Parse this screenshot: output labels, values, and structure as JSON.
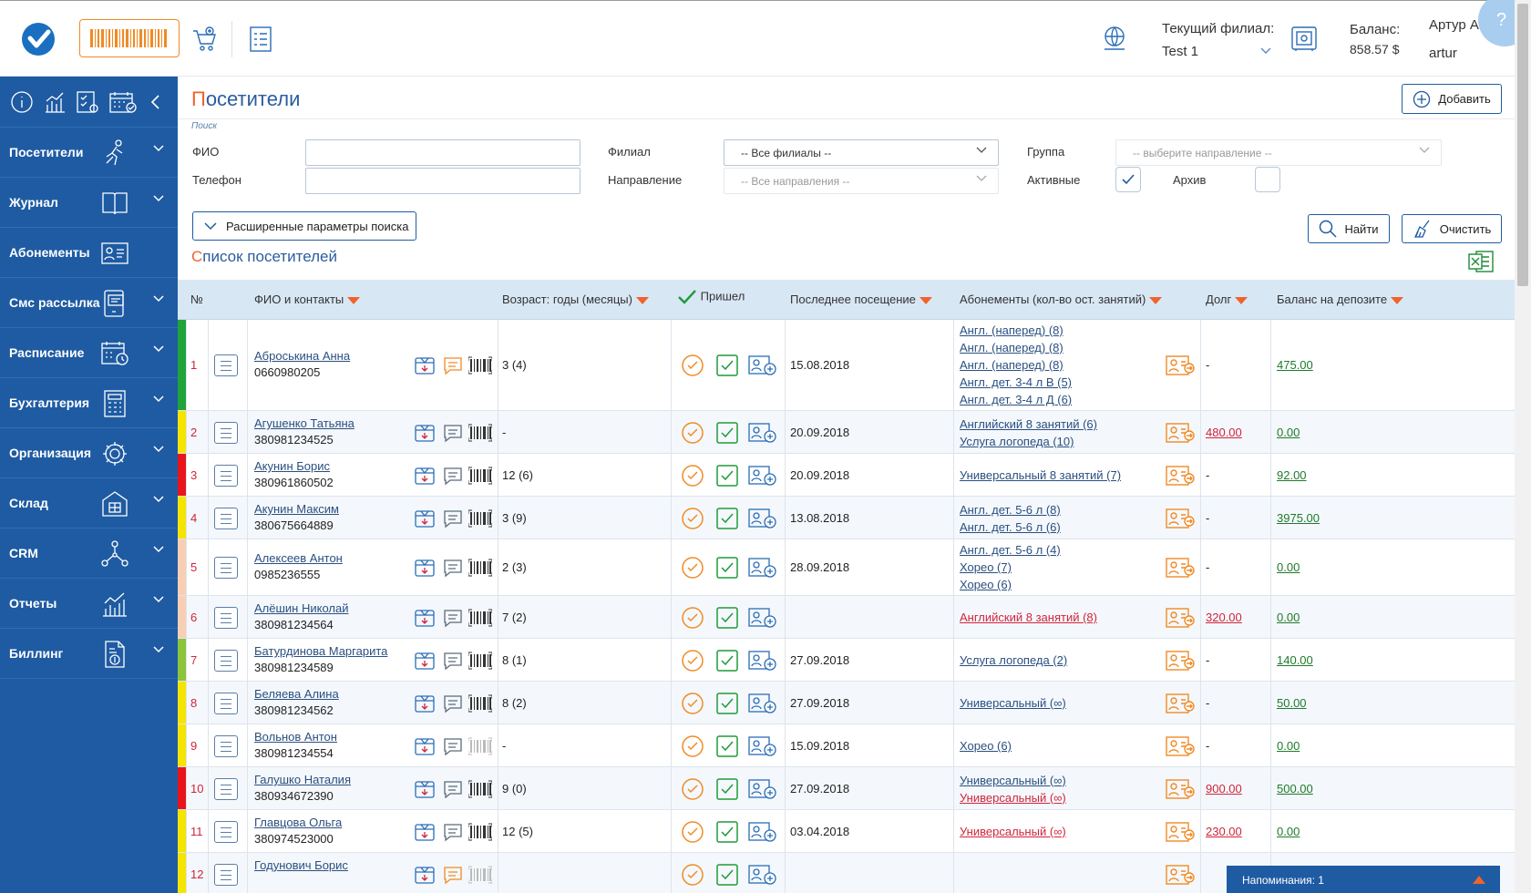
{
  "header": {
    "branch_label": "Текущий филиал:",
    "branch_value": "Test 1",
    "balance_label": "Баланс:",
    "balance_value": "858.57 $",
    "user_name": "Артур А.",
    "user_login": "artur",
    "help": "?"
  },
  "sidebar": {
    "items": [
      {
        "label": "Посетители",
        "icon": "running-person-icon",
        "has_chevron": true
      },
      {
        "label": "Журнал",
        "icon": "book-icon",
        "has_chevron": true
      },
      {
        "label": "Абонементы",
        "icon": "id-card-icon",
        "has_chevron": false
      },
      {
        "label": "Смс рассылка",
        "icon": "sms-device-icon",
        "has_chevron": true
      },
      {
        "label": "Расписание",
        "icon": "calendar-clock-icon",
        "has_chevron": true
      },
      {
        "label": "Бухгалтерия",
        "icon": "calculator-icon",
        "has_chevron": true
      },
      {
        "label": "Организация",
        "icon": "gear-icon",
        "has_chevron": true
      },
      {
        "label": "Склад",
        "icon": "warehouse-icon",
        "has_chevron": true
      },
      {
        "label": "CRM",
        "icon": "network-icon",
        "has_chevron": true
      },
      {
        "label": "Отчеты",
        "icon": "chart-icon",
        "has_chevron": true
      },
      {
        "label": "Биллинг",
        "icon": "invoice-icon",
        "has_chevron": true
      }
    ]
  },
  "page": {
    "title_first": "П",
    "title_rest": "осетители",
    "add_label": "Добавить",
    "search_caption": "Поиск"
  },
  "filters": {
    "fio_label": "ФИО",
    "phone_label": "Телефон",
    "branch_label": "Филиал",
    "branch_value": "-- Все филиалы --",
    "direction_label": "Направление",
    "direction_value": "-- Все направления --",
    "group_label": "Группа",
    "group_value": "-- выберите направление --",
    "active_label": "Активные",
    "active_checked": true,
    "archive_label": "Архив",
    "archive_checked": false,
    "advanced_label": "Расширенные параметры поиска",
    "find_label": "Найти",
    "clear_label": "Очистить"
  },
  "list": {
    "title_first": "С",
    "title_rest": "писок посетителей",
    "columns": {
      "num": "№",
      "name": "ФИО и контакты",
      "age": "Возраст: годы (месяцы)",
      "came": "Пришел",
      "last": "Последнее посещение",
      "subs": "Абонементы (кол-во ост. занятий)",
      "debt": "Долг",
      "deposit": "Баланс на депозите"
    },
    "rows": [
      {
        "num": "1",
        "name": "Аброськина Анна",
        "phone": "0660980205",
        "age": "3 (4)",
        "last": "15.08.2018",
        "subs": [
          {
            "t": "Англ. (наперед) (8)",
            "red": false
          },
          {
            "t": "Англ. (наперед) (8)",
            "red": false
          },
          {
            "t": "Англ. (наперед) (8)",
            "red": false
          },
          {
            "t": "Англ. дет. 3-4 л В (5)",
            "red": false
          },
          {
            "t": "Англ. дет. 3-4 л Д (6)",
            "red": false
          }
        ],
        "debt": "-",
        "debt_red": false,
        "deposit": "475.00",
        "stripe": "#1fa33a",
        "msg_orange": true,
        "barcode_light": false
      },
      {
        "num": "2",
        "name": "Агушенко Татьяна",
        "phone": "380981234525",
        "age": "-",
        "last": "20.09.2018",
        "subs": [
          {
            "t": "Английский 8 занятий (6)",
            "red": false
          },
          {
            "t": "Услуга логопеда (10)",
            "red": false
          }
        ],
        "debt": "480.00",
        "debt_red": true,
        "deposit": "0.00",
        "stripe": "#f5e400",
        "msg_orange": false,
        "barcode_light": false
      },
      {
        "num": "3",
        "name": "Акунин Борис",
        "phone": "380961860502",
        "age": "12 (6)",
        "last": "20.09.2018",
        "subs": [
          {
            "t": "Универсальный 8 занятий (7)",
            "red": false
          }
        ],
        "debt": "-",
        "debt_red": false,
        "deposit": "92.00",
        "stripe": "#e8141c",
        "msg_orange": false,
        "barcode_light": false
      },
      {
        "num": "4",
        "name": "Акунин Максим",
        "phone": "380675664889",
        "age": "3 (9)",
        "last": "13.08.2018",
        "subs": [
          {
            "t": "Англ. дет. 5-6 л (8)",
            "red": false
          },
          {
            "t": "Англ. дет. 5-6 л (6)",
            "red": false
          }
        ],
        "debt": "-",
        "debt_red": false,
        "deposit": "3975.00",
        "stripe": "#f5e400",
        "msg_orange": false,
        "barcode_light": false
      },
      {
        "num": "5",
        "name": "Алексеев Антон",
        "phone": "0985236555",
        "age": "2 (3)",
        "last": "28.09.2018",
        "subs": [
          {
            "t": "Англ. дет. 5-6 л (4)",
            "red": false
          },
          {
            "t": "Хорео (7)",
            "red": false
          },
          {
            "t": "Хорео (6)",
            "red": false
          }
        ],
        "debt": "-",
        "debt_red": false,
        "deposit": "0.00",
        "stripe": "#f8cfb5",
        "msg_orange": false,
        "barcode_light": false
      },
      {
        "num": "6",
        "name": "Алёшин Николай",
        "phone": "380981234564",
        "age": "7 (2)",
        "last": "",
        "subs": [
          {
            "t": "Английский 8 занятий (8)",
            "red": true
          }
        ],
        "debt": "320.00",
        "debt_red": true,
        "deposit": "0.00",
        "stripe": "#f8cfb5",
        "msg_orange": false,
        "barcode_light": false
      },
      {
        "num": "7",
        "name": "Батурдинова Маргарита",
        "phone": "380981234589",
        "age": "8 (1)",
        "last": "27.09.2018",
        "subs": [
          {
            "t": "Услуга логопеда (2)",
            "red": false
          }
        ],
        "debt": "-",
        "debt_red": false,
        "deposit": "140.00",
        "stripe": "#8cc43c",
        "msg_orange": false,
        "barcode_light": false
      },
      {
        "num": "8",
        "name": "Беляева Алина",
        "phone": "380981234562",
        "age": "8 (2)",
        "last": "27.09.2018",
        "subs": [
          {
            "t": "Универсальный (∞)",
            "red": false
          }
        ],
        "debt": "-",
        "debt_red": false,
        "deposit": "50.00",
        "stripe": "#f5e400",
        "msg_orange": false,
        "barcode_light": false
      },
      {
        "num": "9",
        "name": "Вольнов Антон",
        "phone": "380981234554",
        "age": "-",
        "last": "15.09.2018",
        "subs": [
          {
            "t": "Хорео (6)",
            "red": false
          }
        ],
        "debt": "-",
        "debt_red": false,
        "deposit": "0.00",
        "stripe": "#f5e400",
        "msg_orange": false,
        "barcode_light": true
      },
      {
        "num": "10",
        "name": "Галушко Наталия",
        "phone": "380934672390",
        "age": "9 (0)",
        "last": "27.09.2018",
        "subs": [
          {
            "t": "Универсальный (∞)",
            "red": false
          },
          {
            "t": "Универсальный (∞)",
            "red": true
          }
        ],
        "debt": "900.00",
        "debt_red": true,
        "deposit": "500.00",
        "stripe": "#e8141c",
        "msg_orange": false,
        "barcode_light": false
      },
      {
        "num": "11",
        "name": "Главцова Ольга",
        "phone": "380974523000",
        "age": "12 (5)",
        "last": "03.04.2018",
        "subs": [
          {
            "t": "Универсальный (∞)",
            "red": true
          }
        ],
        "debt": "230.00",
        "debt_red": true,
        "deposit": "0.00",
        "stripe": "#f5e400",
        "msg_orange": false,
        "barcode_light": false
      },
      {
        "num": "12",
        "name": "Годунович Борис",
        "phone": "",
        "age": "",
        "last": "",
        "subs": [],
        "debt": "",
        "debt_red": false,
        "deposit": "",
        "stripe": "#f5e400",
        "msg_orange": true,
        "barcode_light": true
      }
    ]
  },
  "reminders": {
    "label": "Напоминания: 1"
  },
  "colors": {
    "brand_blue": "#1e5ba3",
    "accent_orange": "#f0632b",
    "check_green": "#1f9a3a"
  }
}
